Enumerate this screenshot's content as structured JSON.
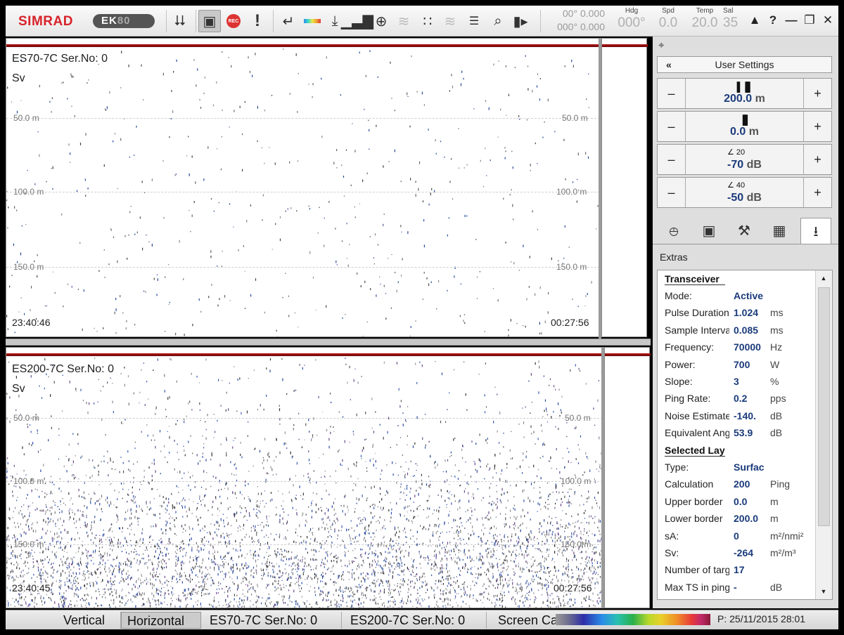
{
  "toolbar": {
    "brand": "SIMRAD",
    "model_a": "EK",
    "model_b": "80",
    "lat": "00° 0.000",
    "lon": "000° 0.000",
    "gauges": [
      {
        "label": "Hdg",
        "value": "000°"
      },
      {
        "label": "Spd",
        "value": "0.0"
      },
      {
        "label": "Temp",
        "value": "20.0"
      },
      {
        "label": "Sal",
        "value": "35"
      }
    ],
    "icons": [
      "collapse-icon",
      "camera-icon",
      "record-icon",
      "alert-icon",
      "return-icon",
      "color-scale-icon",
      "depth-range-icon",
      "bar-chart-icon",
      "target-icon",
      "layer-icon",
      "scatter-icon",
      "layer-chart-icon",
      "numbered-list-icon",
      "zoom-icon",
      "battery-icon"
    ],
    "rec_label": "REC",
    "alert_glyph": "!",
    "help_glyph": "?"
  },
  "echo_top": {
    "title": "ES70-7C Ser.No: 0",
    "variable": "Sv",
    "depths": [
      "50.0 m",
      "100.0 m",
      "150.0 m"
    ],
    "time_left": "23:40:46",
    "time_right": "00:27:56"
  },
  "echo_bottom": {
    "title": "ES200-7C Ser.No: 0",
    "variable": "Sv",
    "depths": [
      "50.0 m",
      "100.0 m",
      "150.0 m"
    ],
    "time_left": "23:40:45",
    "time_right": "00:27:56"
  },
  "panel": {
    "user_settings": "User Settings",
    "range": {
      "value": "200.0",
      "unit": "m"
    },
    "start": {
      "value": "0.0",
      "unit": "m"
    },
    "gain1": {
      "value": "-70",
      "unit": "dB",
      "slope": "20"
    },
    "gain2": {
      "value": "-50",
      "unit": "dB",
      "slope": "40"
    },
    "extras_label": "Extras",
    "transceiver_header": "Transceiver",
    "transceiver": [
      {
        "k": "Mode:",
        "v": "Active",
        "u": ""
      },
      {
        "k": "Pulse Duration:",
        "v": "1.024",
        "u": "ms"
      },
      {
        "k": "Sample Interval:",
        "v": "0.085",
        "u": "ms"
      },
      {
        "k": "Frequency:",
        "v": "70000",
        "u": "Hz"
      },
      {
        "k": "Power:",
        "v": "700",
        "u": "W"
      },
      {
        "k": "Slope:",
        "v": "3",
        "u": "%"
      },
      {
        "k": "Ping Rate:",
        "v": "0.2",
        "u": "pps"
      },
      {
        "k": "Noise Estimate:",
        "v": "-140.",
        "u": "dB"
      },
      {
        "k": "Equivalent Angle:",
        "v": "53.9",
        "u": "dB"
      }
    ],
    "layer_header": "Selected Layer",
    "layer": [
      {
        "k": "Type:",
        "v": "Surface",
        "u": ""
      },
      {
        "k": "Calculation",
        "v": "200",
        "u": "Ping"
      },
      {
        "k": "Upper border",
        "v": "0.0",
        "u": "m"
      },
      {
        "k": "Lower border",
        "v": "200.0",
        "u": "m"
      },
      {
        "k": "sA:",
        "v": "0",
        "u": "m²/nmi²"
      },
      {
        "k": "Sv:",
        "v": "-264",
        "u": "m²/m³"
      },
      {
        "k": "Number of targets",
        "v": "17",
        "u": ""
      },
      {
        "k": "Max TS in ping",
        "v": "-",
        "u": "dB"
      }
    ]
  },
  "status": {
    "tabs": [
      "Vertical",
      "Horizontal",
      "ES70-7C Ser.No: 0",
      "ES200-7C Ser.No: 0",
      "Screen Capture"
    ],
    "active_tab": 1,
    "ping_time": "P: 25/11/2015   28:01"
  }
}
